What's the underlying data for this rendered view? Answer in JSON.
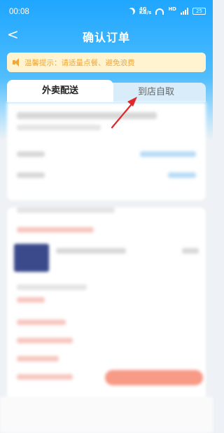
{
  "status": {
    "time": "00:08",
    "battery": "25"
  },
  "nav": {
    "back": "<",
    "title": "确认订单"
  },
  "tip": {
    "text": "温馨提示：请适量点餐、避免浪费"
  },
  "tabs": [
    {
      "label": "外卖配送",
      "active": true
    },
    {
      "label": "到店自取",
      "active": false
    }
  ],
  "colors": {
    "brand": "#1fa6ff",
    "tip_text": "#f0a73a",
    "annotation_arrow": "#e0282a"
  }
}
